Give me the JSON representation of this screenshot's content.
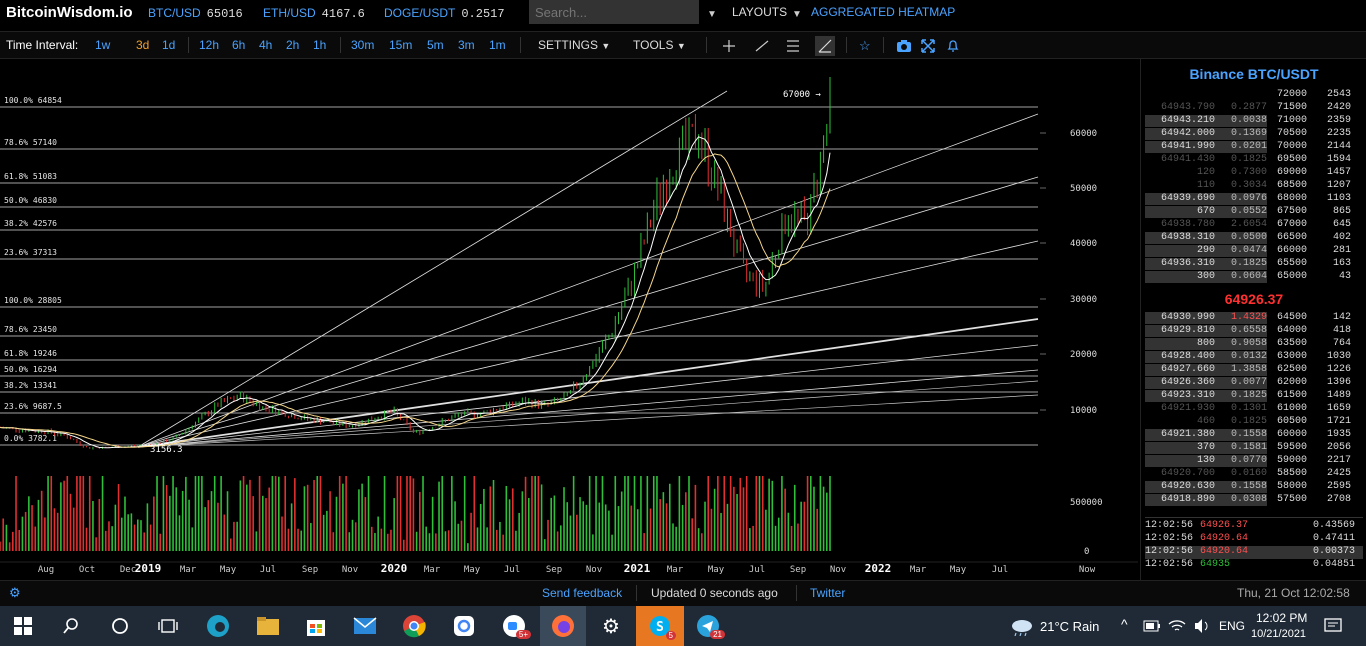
{
  "topbar": {
    "logo": "BitcoinWisdom.io",
    "tickers": [
      {
        "symbol": "BTC/USD",
        "value": "65016"
      },
      {
        "symbol": "ETH/USD",
        "value": "4167.6"
      },
      {
        "symbol": "DOGE/USDT",
        "value": "0.2517"
      }
    ],
    "search_placeholder": "Search...",
    "layouts_label": "LAYOUTS",
    "heatmap_label": "AGGREGATED HEATMAP"
  },
  "toolbar": {
    "time_interval_label": "Time Interval:",
    "intervals_a": [
      "1w",
      "3d",
      "1d"
    ],
    "intervals_b": [
      "12h",
      "6h",
      "4h",
      "2h",
      "1h"
    ],
    "intervals_c": [
      "30m",
      "15m",
      "5m",
      "3m",
      "1m"
    ],
    "active_interval": "3d",
    "settings_label": "SETTINGS",
    "tools_label": "TOOLS",
    "drawing_icons": [
      "crosshair-icon",
      "line-icon",
      "fib-lines-icon",
      "pen-icon"
    ],
    "action_icons": [
      "star-icon",
      "camera-icon",
      "fullscreen-icon",
      "bell-icon"
    ]
  },
  "chart_data": {
    "type": "candlestick",
    "fib_levels": [
      {
        "label": "100.0% 64854",
        "value": 64854
      },
      {
        "label": "78.6% 57140",
        "value": 57140
      },
      {
        "label": "61.8% 51083",
        "value": 51083
      },
      {
        "label": "50.0% 46830",
        "value": 46830
      },
      {
        "label": "38.2% 42576",
        "value": 42576
      },
      {
        "label": "23.6% 37313",
        "value": 37313
      },
      {
        "label": "100.0% 28805",
        "value": 28805
      },
      {
        "label": "78.6% 23450",
        "value": 23450
      },
      {
        "label": "61.8% 19246",
        "value": 19246
      },
      {
        "label": "50.0% 16294",
        "value": 16294
      },
      {
        "label": "38.2% 13341",
        "value": 13341
      },
      {
        "label": "23.6% 9687.5",
        "value": 9687.5
      },
      {
        "label": "0.0% 3782.1",
        "value": 3782.1
      }
    ],
    "price_axis": [
      "60000",
      "50000",
      "40000",
      "30000",
      "20000",
      "10000"
    ],
    "volume_axis": [
      "500000",
      "0"
    ],
    "x_axis": [
      "Aug",
      "Oct",
      "Dec",
      "2019",
      "Mar",
      "May",
      "Jul",
      "Sep",
      "Nov",
      "2020",
      "Mar",
      "May",
      "Jul",
      "Sep",
      "Nov",
      "2021",
      "Mar",
      "May",
      "Jul",
      "Sep",
      "Nov",
      "2022",
      "Mar",
      "May",
      "Jul",
      "Now"
    ],
    "bold_ticks": [
      "2019",
      "2020",
      "2021",
      "2022"
    ],
    "annotations": [
      "67000 →",
      "3156.3"
    ],
    "ylim": [
      0,
      72000
    ],
    "price_series": [
      [
        "2018-08",
        7000
      ],
      [
        "2018-09",
        6600
      ],
      [
        "2018-10",
        6400
      ],
      [
        "2018-11",
        5600
      ],
      [
        "2018-12",
        3500
      ],
      [
        "2019-01",
        3600
      ],
      [
        "2019-02",
        3800
      ],
      [
        "2019-03",
        4000
      ],
      [
        "2019-04",
        5200
      ],
      [
        "2019-05",
        8000
      ],
      [
        "2019-06",
        11000
      ],
      [
        "2019-07",
        12500
      ],
      [
        "2019-08",
        10500
      ],
      [
        "2019-09",
        9500
      ],
      [
        "2019-10",
        8500
      ],
      [
        "2019-11",
        8000
      ],
      [
        "2019-12",
        7300
      ],
      [
        "2020-01",
        8500
      ],
      [
        "2020-02",
        9800
      ],
      [
        "2020-03",
        6000
      ],
      [
        "2020-04",
        7500
      ],
      [
        "2020-05",
        9200
      ],
      [
        "2020-06",
        9400
      ],
      [
        "2020-07",
        10500
      ],
      [
        "2020-08",
        11500
      ],
      [
        "2020-09",
        10800
      ],
      [
        "2020-10",
        12500
      ],
      [
        "2020-11",
        17500
      ],
      [
        "2020-12",
        24000
      ],
      [
        "2021-01",
        34000
      ],
      [
        "2021-02",
        47000
      ],
      [
        "2021-03",
        56000
      ],
      [
        "2021-04",
        60000
      ],
      [
        "2021-05",
        48000
      ],
      [
        "2021-06",
        35000
      ],
      [
        "2021-07",
        32000
      ],
      [
        "2021-08",
        45000
      ],
      [
        "2021-09",
        44000
      ],
      [
        "2021-10",
        64500
      ]
    ]
  },
  "orderbook": {
    "title": "Binance BTC/USDT",
    "asks": [
      {
        "price": "64943.790",
        "amount": "0.2877",
        "dim": true
      },
      {
        "price": "64943.210",
        "amount": "0.0038",
        "dim": false
      },
      {
        "price": "64942.000",
        "amount": "0.1369",
        "dim": false
      },
      {
        "price": "64941.990",
        "amount": "0.0201",
        "dim": false
      },
      {
        "price": "64941.430",
        "amount": "0.1825",
        "dim": true
      },
      {
        "price": "120",
        "amount": "0.7300",
        "dim": true
      },
      {
        "price": "110",
        "amount": "0.3034",
        "dim": true
      },
      {
        "price": "64939.690",
        "amount": "0.0976",
        "dim": false
      },
      {
        "price": "670",
        "amount": "0.0552",
        "dim": false
      },
      {
        "price": "64938.780",
        "amount": "2.6054",
        "dim": true
      },
      {
        "price": "64938.310",
        "amount": "0.0500",
        "dim": false
      },
      {
        "price": "290",
        "amount": "0.0474",
        "dim": false
      },
      {
        "price": "64936.310",
        "amount": "0.1825",
        "dim": false
      },
      {
        "price": "300",
        "amount": "0.0604",
        "dim": false
      }
    ],
    "ask_levels": [
      {
        "level": "72000",
        "count": "2543"
      },
      {
        "level": "71500",
        "count": "2420"
      },
      {
        "level": "71000",
        "count": "2359"
      },
      {
        "level": "70500",
        "count": "2235"
      },
      {
        "level": "70000",
        "count": "2144"
      },
      {
        "level": "69500",
        "count": "1594"
      },
      {
        "level": "69000",
        "count": "1457"
      },
      {
        "level": "68500",
        "count": "1207"
      },
      {
        "level": "68000",
        "count": "1103"
      },
      {
        "level": "67500",
        "count": "865"
      },
      {
        "level": "67000",
        "count": "645"
      },
      {
        "level": "66500",
        "count": "402"
      },
      {
        "level": "66000",
        "count": "281"
      },
      {
        "level": "65500",
        "count": "163"
      },
      {
        "level": "65000",
        "count": "43"
      }
    ],
    "mid_price": "64926.37",
    "bids": [
      {
        "price": "64930.990",
        "amount": "1.4329",
        "dim": false
      },
      {
        "price": "64929.810",
        "amount": "0.6558",
        "dim": false
      },
      {
        "price": "800",
        "amount": "0.9058",
        "dim": false
      },
      {
        "price": "64928.400",
        "amount": "0.0132",
        "dim": false
      },
      {
        "price": "64927.660",
        "amount": "1.3858",
        "dim": false
      },
      {
        "price": "64926.360",
        "amount": "0.0077",
        "dim": false
      },
      {
        "price": "64923.310",
        "amount": "0.1825",
        "dim": false
      },
      {
        "price": "64921.930",
        "amount": "0.1301",
        "dim": true
      },
      {
        "price": "460",
        "amount": "0.1825",
        "dim": true
      },
      {
        "price": "64921.380",
        "amount": "0.1558",
        "dim": false
      },
      {
        "price": "370",
        "amount": "0.1581",
        "dim": false
      },
      {
        "price": "130",
        "amount": "0.0770",
        "dim": false
      },
      {
        "price": "64920.700",
        "amount": "0.0160",
        "dim": true
      },
      {
        "price": "64920.630",
        "amount": "0.1558",
        "dim": false
      },
      {
        "price": "64918.890",
        "amount": "0.0308",
        "dim": false
      }
    ],
    "bid_levels": [
      {
        "level": "64500",
        "count": "142"
      },
      {
        "level": "64000",
        "count": "418"
      },
      {
        "level": "63500",
        "count": "764"
      },
      {
        "level": "63000",
        "count": "1030"
      },
      {
        "level": "62500",
        "count": "1226"
      },
      {
        "level": "62000",
        "count": "1396"
      },
      {
        "level": "61500",
        "count": "1489"
      },
      {
        "level": "61000",
        "count": "1659"
      },
      {
        "level": "60500",
        "count": "1721"
      },
      {
        "level": "60000",
        "count": "1935"
      },
      {
        "level": "59500",
        "count": "2056"
      },
      {
        "level": "59000",
        "count": "2217"
      },
      {
        "level": "58500",
        "count": "2425"
      },
      {
        "level": "58000",
        "count": "2595"
      },
      {
        "level": "57500",
        "count": "2708"
      }
    ],
    "trades": [
      {
        "time": "12:02:56",
        "price": "64926.37",
        "amount": "0.43569",
        "side": "sell"
      },
      {
        "time": "12:02:56",
        "price": "64920.64",
        "amount": "0.47411",
        "side": "sell"
      },
      {
        "time": "12:02:56",
        "price": "64920.64",
        "amount": "0.00373",
        "side": "sell"
      },
      {
        "time": "12:02:56",
        "price": "64935",
        "amount": "0.04851",
        "side": "buy"
      }
    ]
  },
  "statusbar": {
    "send_feedback": "Send feedback",
    "updated": "Updated 0 seconds ago",
    "twitter": "Twitter",
    "datetime": "Thu, 21 Oct 12:02:58"
  },
  "taskbar": {
    "weather": "21°C  Rain",
    "language": "ENG",
    "time": "12:02 PM",
    "date": "10/21/2021",
    "badges": {
      "zoom": "5+",
      "skype": "5",
      "telegram": "21"
    }
  },
  "colors": {
    "accent": "#4aa3ff",
    "active": "#f0a030",
    "up": "#2fbf3a",
    "down": "#e03030",
    "taskbar": "#1f2a36"
  }
}
